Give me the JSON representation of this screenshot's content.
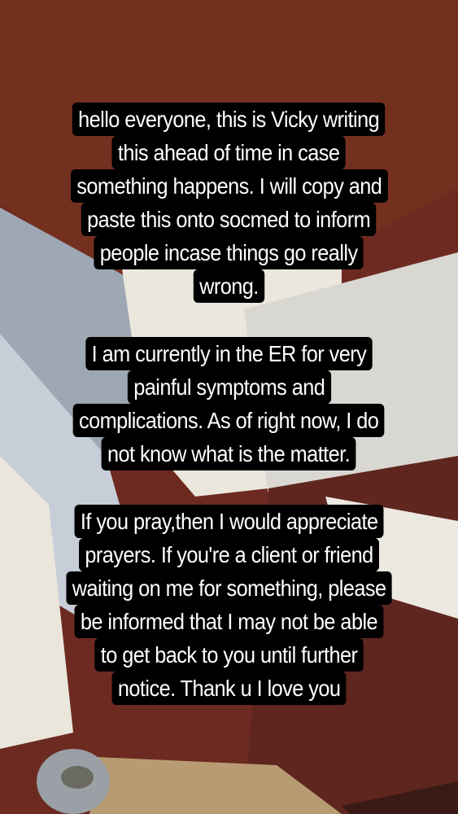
{
  "story": {
    "block1": [
      "hello everyone, this is Vicky writing",
      "this ahead of time in case",
      "something happens. I will copy and",
      "paste this onto socmed to inform",
      "people incase things go really",
      "wrong."
    ],
    "block2": [
      "I am currently in the ER for very",
      "painful symptoms and",
      "complications. As of right now, I do",
      "not know what is the matter."
    ],
    "block3": [
      "If you pray,then I would appreciate",
      "prayers. If you're a client or friend",
      "waiting on me for something, please",
      "be informed that I may not be able",
      "to get back to you until further",
      "notice. Thank u I love you"
    ]
  },
  "colors": {
    "ceiling": "#6e2a20",
    "wall": "#e6e2d8",
    "text_bg": "#000000",
    "text": "#ffffff"
  }
}
